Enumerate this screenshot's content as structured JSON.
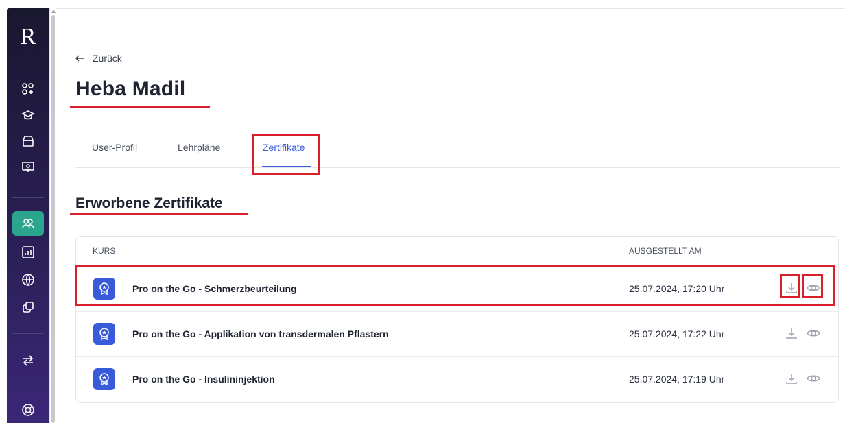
{
  "sidebar": {
    "logo": "R",
    "items": [
      {
        "icon": "apps-add-icon"
      },
      {
        "icon": "graduation-cap-icon"
      },
      {
        "icon": "archive-icon"
      },
      {
        "icon": "monitor-user-icon"
      },
      {
        "icon": "users-icon",
        "active": true
      },
      {
        "icon": "chart-icon"
      },
      {
        "icon": "globe-icon"
      },
      {
        "icon": "copy-icon"
      },
      {
        "icon": "switch-arrows-icon"
      },
      {
        "icon": "help-lifebuoy-icon"
      }
    ]
  },
  "page": {
    "back_label": "Zurück",
    "user_name": "Heba Madil",
    "tabs": [
      {
        "label": "User-Profil"
      },
      {
        "label": "Lehrpläne"
      },
      {
        "label": "Zertifikate",
        "active": true
      }
    ],
    "section_title": "Erworbene Zertifikate"
  },
  "table": {
    "headers": {
      "course": "KURS",
      "issued": "AUSGESTELLT AM"
    },
    "rows": [
      {
        "course": "Pro on the Go - Schmerzbeurteilung",
        "issued": "25.07.2024, 17:20 Uhr"
      },
      {
        "course": "Pro on the Go - Applikation von transdermalen Pflastern",
        "issued": "25.07.2024, 17:22 Uhr"
      },
      {
        "course": "Pro on the Go - Insulininjektion",
        "issued": "25.07.2024, 17:19 Uhr"
      }
    ]
  },
  "colors": {
    "accent": "#3a5bd9",
    "active_nav": "#2ba58d",
    "highlight": "#d8202b"
  }
}
